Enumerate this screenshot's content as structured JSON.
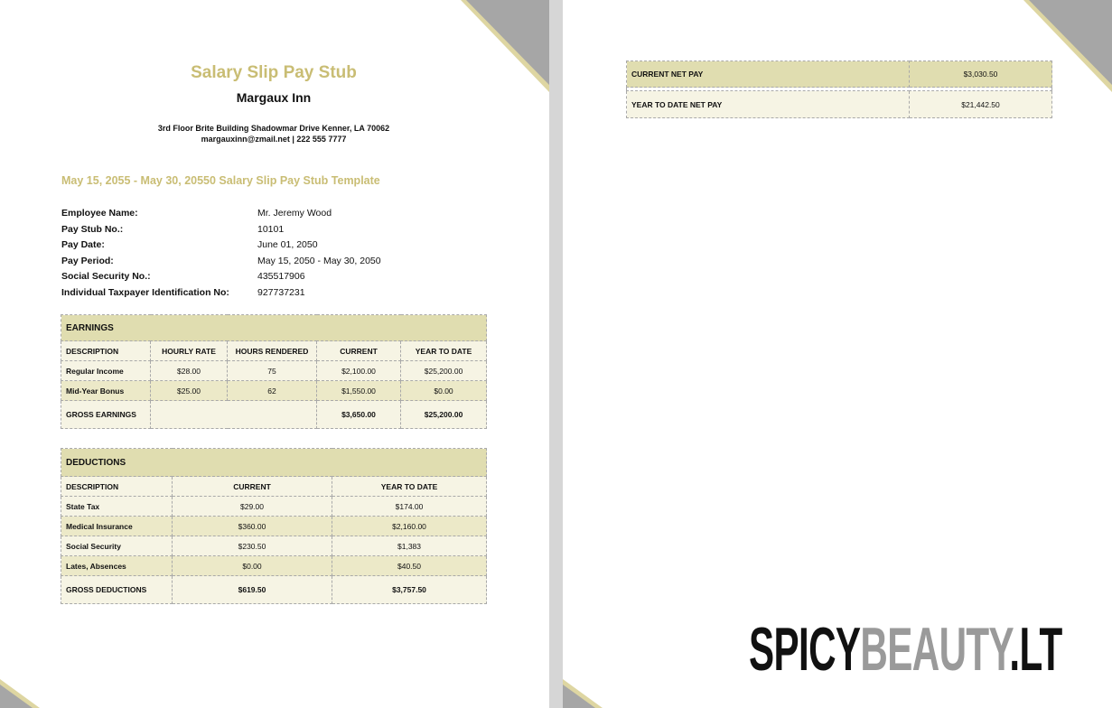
{
  "document": {
    "title": "Salary Slip Pay Stub",
    "company": "Margaux Inn",
    "address_line1": "3rd Floor Brite Building Shadowmar Drive Kenner, LA 70062",
    "address_line2": "margauxinn@zmail.net | 222 555 7777",
    "period_heading": "May 15, 2055 - May 30, 20550 Salary Slip Pay Stub Template"
  },
  "employee": [
    {
      "label": "Employee Name:",
      "value": "Mr. Jeremy Wood"
    },
    {
      "label": "Pay Stub No.:",
      "value": "10101"
    },
    {
      "label": "Pay Date:",
      "value": "June 01, 2050"
    },
    {
      "label": "Pay Period:",
      "value": "May 15, 2050 - May 30, 2050"
    },
    {
      "label": "Social Security No.:",
      "value": "435517906"
    },
    {
      "label": "Individual Taxpayer Identification No:",
      "value": "927737231"
    }
  ],
  "earnings": {
    "heading": "EARNINGS",
    "columns": [
      "DESCRIPTION",
      "HOURLY RATE",
      "HOURS RENDERED",
      "CURRENT",
      "YEAR TO DATE"
    ],
    "rows": [
      [
        "Regular Income",
        "$28.00",
        "75",
        "$2,100.00",
        "$25,200.00"
      ],
      [
        "Mid-Year Bonus",
        "$25.00",
        "62",
        "$1,550.00",
        "$0.00"
      ]
    ],
    "total_label": "GROSS EARNINGS",
    "total_current": "$3,650.00",
    "total_ytd": "$25,200.00"
  },
  "deductions": {
    "heading": "DEDUCTIONS",
    "columns": [
      "DESCRIPTION",
      "CURRENT",
      "YEAR TO DATE"
    ],
    "rows": [
      [
        "State Tax",
        "$29.00",
        "$174.00"
      ],
      [
        "Medical Insurance",
        "$360.00",
        "$2,160.00"
      ],
      [
        "Social Security",
        "$230.50",
        "$1,383"
      ],
      [
        "Lates, Absences",
        "$0.00",
        "$40.50"
      ]
    ],
    "total_label": "GROSS DEDUCTIONS",
    "total_current": "$619.50",
    "total_ytd": "$3,757.50"
  },
  "net_pay": {
    "current_label": "CURRENT NET PAY",
    "current_value": "$3,030.50",
    "ytd_label": "YEAR TO DATE NET PAY",
    "ytd_value": "$21,442.50"
  },
  "watermark": {
    "part1": "SPICY",
    "part2": "BEAUTY",
    "part3": ".LT"
  },
  "colors": {
    "accent": "#c9bd74",
    "table_header": "#e0ddb0",
    "table_row_light": "#f6f4e4",
    "table_row_alt": "#ece9c8",
    "corner_gray": "#a6a6a6",
    "corner_gold": "#ded6a2"
  }
}
